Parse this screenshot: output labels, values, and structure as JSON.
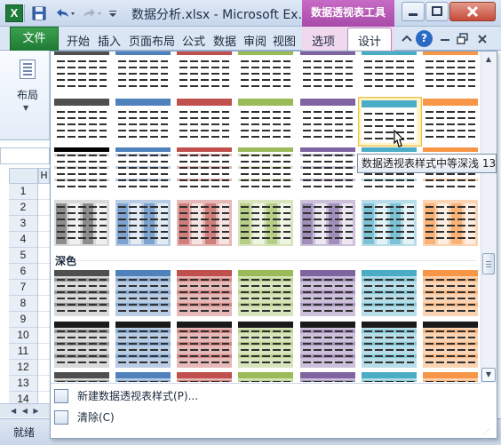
{
  "window": {
    "title": "数据分析.xlsx - Microsoft Ex...",
    "contextual_tab_group": "数据透视表工具",
    "app_icon": "X",
    "min_icon": "minimize-icon",
    "max_icon": "restore-icon",
    "close_icon": "close-icon"
  },
  "quick_access": {
    "icons": [
      "save-icon",
      "undo-icon",
      "redo-icon",
      "customize-icon"
    ]
  },
  "ribbon": {
    "file_tab": "文件",
    "tabs": [
      "开始",
      "插入",
      "页面布局",
      "公式",
      "数据",
      "审阅",
      "视图",
      "选项",
      "设计"
    ],
    "active_tab": "设计",
    "layout_group_label": "布局"
  },
  "sheet": {
    "column_header": "H",
    "row_numbers": [
      "1",
      "2",
      "3",
      "4",
      "5",
      "6",
      "7",
      "8",
      "9",
      "10",
      "11",
      "12",
      "13",
      "14"
    ],
    "nav_arrows": "◀ ◀ ▶",
    "status": "就绪"
  },
  "gallery": {
    "section_dark_label": "深色",
    "tooltip": "数据透视表样式中等深浅 13",
    "hovered_style": "数据透视表样式中等深浅 13",
    "accent_colors": [
      "#4f4f4f",
      "#4f81bd",
      "#c0504d",
      "#9bbb59",
      "#8064a2",
      "#4bacc6",
      "#f79646"
    ],
    "light_colors": [
      "#d9d9d9",
      "#b8cce4",
      "#e6b8b7",
      "#d7e4bc",
      "#ccc0da",
      "#b7dee8",
      "#fbd4b4"
    ]
  },
  "menu": {
    "new_style": "新建数据透视表样式(P)...",
    "clear": "清除(C)"
  }
}
